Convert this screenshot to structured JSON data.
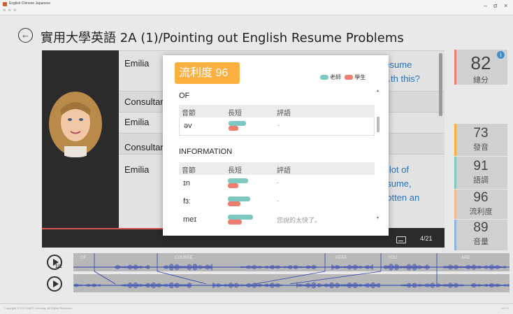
{
  "window": {
    "title": "English Chinese Japanese",
    "nav_mini": "⊙ ⊙ ⊙",
    "minimize": "–",
    "maximize": "σ",
    "close": "×"
  },
  "header": {
    "back_icon": "arrow-left-circle",
    "title": "實用大學英語 2A (1)/Pointing out English Resume Problems"
  },
  "dialog": {
    "rows": [
      {
        "speaker": "Emilia",
        "text": "resume\n…th this?"
      },
      {
        "speaker": "Consultant",
        "text": "?"
      },
      {
        "speaker": "Emilia",
        "text": ""
      },
      {
        "speaker": "Consultant",
        "text": ""
      },
      {
        "speaker": "Emilia",
        "text": "a lot of\nesume,\ngotten an"
      }
    ]
  },
  "player": {
    "counter": "4/21",
    "subtitle_icon": "subtitle-icon"
  },
  "scores": [
    {
      "value": "82",
      "label": "總分",
      "color": "#ef7d6f"
    },
    {
      "value": "73",
      "label": "發音",
      "color": "#fbb040"
    },
    {
      "value": "91",
      "label": "語調",
      "color": "#7dc8c0"
    },
    {
      "value": "96",
      "label": "流利度",
      "color": "#f6b88a"
    },
    {
      "value": "89",
      "label": "音量",
      "color": "#8fb4de"
    }
  ],
  "popup": {
    "badge": "流利度 96",
    "legend": {
      "teacher": "老師",
      "student": "學生",
      "teacher_color": "#7dc8c0",
      "student_color": "#ef7d6f"
    },
    "headers": {
      "syllable": "音節",
      "length": "長短",
      "comment": "評語"
    },
    "sections": [
      {
        "word": "OF",
        "rows": [
          {
            "phoneme": "əv",
            "teacher": 0.35,
            "student": 0.2,
            "comment": "-"
          }
        ]
      },
      {
        "word": "INFORMATION",
        "rows": [
          {
            "phoneme": "ɪn",
            "teacher": 0.42,
            "student": 0.22,
            "comment": "-"
          },
          {
            "phoneme": "fɜː",
            "teacher": 0.45,
            "student": 0.25,
            "comment": "-"
          },
          {
            "phoneme": "meɪ",
            "teacher": 0.52,
            "student": 0.28,
            "comment": "您說的太快了。"
          }
        ]
      }
    ]
  },
  "waveform": {
    "words": [
      "OF",
      "COURSE",
      "HERE",
      "YOU",
      "ARE"
    ],
    "speed_label": "1/2"
  },
  "footer": {
    "left": "Copyright © 2021 MyET Learning. All Rights Reserved.",
    "right": "v8.2.1"
  }
}
